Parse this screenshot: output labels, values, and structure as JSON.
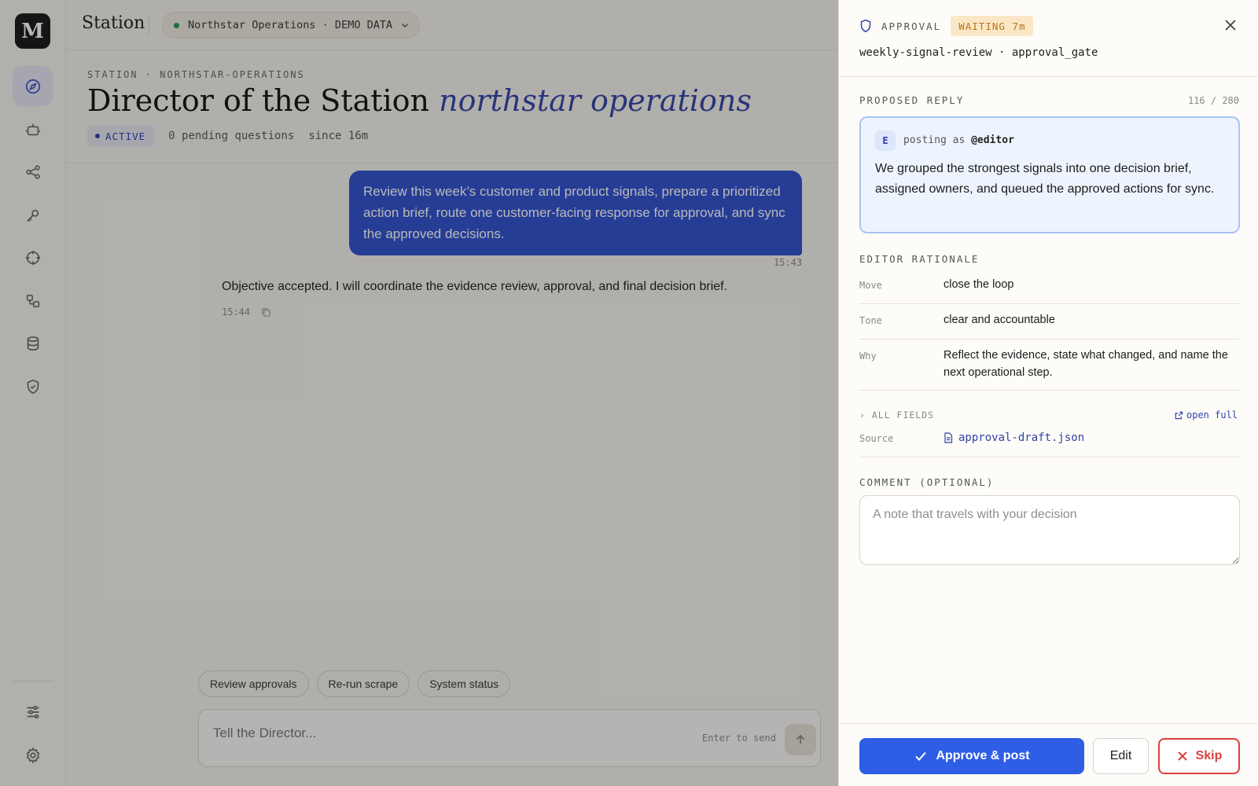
{
  "app": {
    "logo_letter": "M",
    "title": "Station"
  },
  "workspace": {
    "label": "Northstar Operations · DEMO DATA",
    "status_color": "#1f9a4a"
  },
  "rail": {
    "items": [
      {
        "icon": "compass-icon",
        "active": true
      },
      {
        "icon": "robot-icon"
      },
      {
        "icon": "share-icon"
      },
      {
        "icon": "key-icon"
      },
      {
        "icon": "crosshair-icon"
      },
      {
        "icon": "workflow-icon"
      },
      {
        "icon": "database-icon"
      },
      {
        "icon": "shield-check-icon"
      }
    ],
    "bottom": [
      {
        "icon": "sliders-icon"
      },
      {
        "icon": "gear-icon"
      }
    ]
  },
  "header": {
    "eyebrow": "STATION · NORTHSTAR-OPERATIONS",
    "title_main": "Director of the Station",
    "title_accent": "northstar operations",
    "status": "ACTIVE",
    "pending": "0 pending questions",
    "since": "since 16m"
  },
  "chat": {
    "user_message": "Review this week’s customer and product signals, prepare a prioritized action brief, route one customer-facing response for approval, and sync the approved decisions.",
    "user_time": "15:43",
    "agent_message": "Objective accepted. I will coordinate the evidence review, approval, and final decision brief.",
    "agent_time": "15:44"
  },
  "chips": [
    "Review approvals",
    "Re-run scrape",
    "System status"
  ],
  "composer": {
    "placeholder": "Tell the Director...",
    "hint": "Enter to send"
  },
  "panel": {
    "kicker": "APPROVAL",
    "waiting": "WAITING 7m",
    "subtitle": "weekly-signal-review · approval_gate",
    "proposed_label": "PROPOSED REPLY",
    "counter": "116 / 280",
    "avatar": "E",
    "posting_prefix": "posting as",
    "posting_handle": "@editor",
    "reply": "We grouped the strongest signals into one decision brief, assigned owners, and queued the approved actions for sync.",
    "rationale_label": "EDITOR RATIONALE",
    "rationale": [
      {
        "key": "Move",
        "value": "close the loop"
      },
      {
        "key": "Tone",
        "value": "clear and accountable"
      },
      {
        "key": "Why",
        "value": "Reflect the evidence, state what changed, and name the next operational step."
      }
    ],
    "all_fields": "› ALL FIELDS",
    "open_full": "open full",
    "source_key": "Source",
    "source_file": "approval-draft.json",
    "comment_label": "COMMENT (OPTIONAL)",
    "comment_placeholder": "A note that travels with your decision",
    "approve": "Approve & post",
    "edit": "Edit",
    "skip": "Skip"
  },
  "colors": {
    "accent": "#3242a8",
    "primary_button": "#2f5ee6",
    "danger": "#d94040",
    "waiting": "#b7741b"
  }
}
